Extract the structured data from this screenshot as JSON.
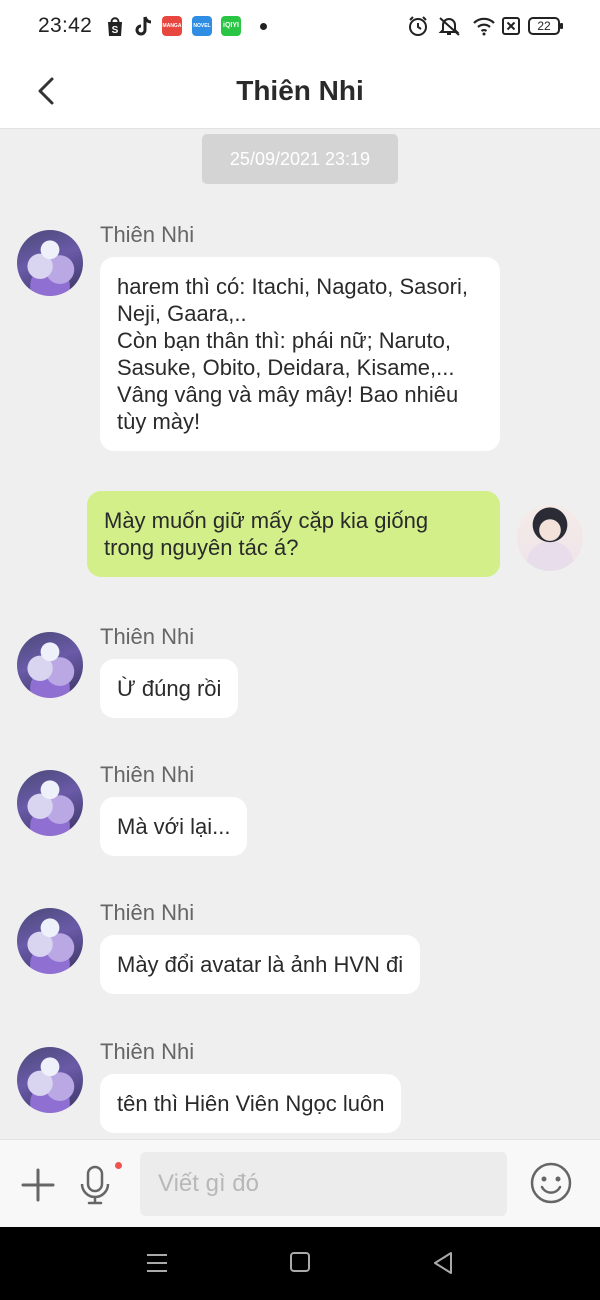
{
  "status_bar": {
    "time": "23:42",
    "apps": [
      {
        "icon": "shopee-icon",
        "color": "#222222",
        "label": ""
      },
      {
        "icon": "tiktok-icon",
        "color": "#222222",
        "label": ""
      },
      {
        "icon": "mangatoon-icon",
        "color": "#e8473f",
        "label": "MANGA TOON"
      },
      {
        "icon": "noveltoon-icon",
        "color": "#2f8de4",
        "label": "NOVEL TOON"
      },
      {
        "icon": "iqiyi-icon",
        "color": "#29c545",
        "label": "iQIYI"
      }
    ],
    "battery": "22",
    "right_icons": [
      "alarm-icon",
      "mute-icon",
      "wifi-icon",
      "sim-off-icon",
      "battery-icon"
    ]
  },
  "header": {
    "title": "Thiên Nhi",
    "back_icon": "chevron-left-icon"
  },
  "chat": {
    "date": "25/09/2021 23:19",
    "messages": [
      {
        "from": "them",
        "sender": "Thiên Nhi",
        "text": "harem thì có: Itachi, Nagato, Sasori,\nNeji, Gaara,..\nCòn bạn thân thì: phái nữ; Naruto,\nSasuke, Obito, Deidara, Kisame,...\nVâng vâng và mây mây! Bao nhiêu\ntùy mày!"
      },
      {
        "from": "me",
        "sender": "",
        "text": "Mày muốn giữ mấy cặp kia giống\ntrong nguyên tác á?"
      },
      {
        "from": "them",
        "sender": "Thiên Nhi",
        "text": "Ừ đúng rồi"
      },
      {
        "from": "them",
        "sender": "Thiên Nhi",
        "text": "Mà với lại..."
      },
      {
        "from": "them",
        "sender": "Thiên Nhi",
        "text": "Mày đổi avatar là ảnh HVN đi"
      },
      {
        "from": "them",
        "sender": "Thiên Nhi",
        "text": "tên thì Hiên Viên Ngọc luôn"
      }
    ]
  },
  "input_bar": {
    "placeholder": "Viết gì đó",
    "value": "",
    "left_icons": [
      "plus-icon",
      "microphone-icon"
    ],
    "right_icon": "smiley-icon"
  },
  "nav_bar": {
    "icons": [
      "menu-icon",
      "home-icon",
      "back-icon"
    ]
  },
  "colors": {
    "my_bubble": "#d2ef8a",
    "their_bubble": "#ffffff",
    "chat_bg": "#efefef"
  }
}
